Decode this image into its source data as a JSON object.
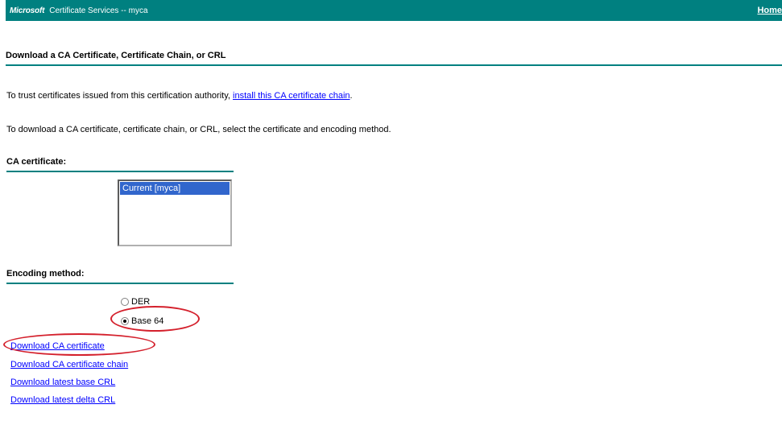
{
  "header": {
    "brand": "Microsoft",
    "title": "Certificate Services  --  myca",
    "home_label": "Home"
  },
  "page": {
    "title": "Download a CA Certificate, Certificate Chain, or CRL",
    "trust_text": "To trust certificates issued from this certification authority, ",
    "trust_link": "install this CA certificate chain",
    "instructions": "To download a CA certificate, certificate chain, or CRL, select the certificate and encoding method."
  },
  "ca_certificate": {
    "label": "CA certificate:",
    "options": [
      "Current [myca]"
    ],
    "selected": "Current [myca]"
  },
  "encoding": {
    "label": "Encoding method:",
    "options": [
      {
        "label": "DER",
        "checked": false
      },
      {
        "label": "Base 64",
        "checked": true
      }
    ]
  },
  "links": {
    "download_ca_cert": "Download CA certificate",
    "download_ca_chain": "Download CA certificate chain",
    "download_base_crl": "Download latest base CRL",
    "download_delta_crl": "Download latest delta CRL"
  },
  "colors": {
    "header_bg": "#008080",
    "link": "#0000ff",
    "selection": "#3166cc",
    "annotation": "#d4202c"
  }
}
